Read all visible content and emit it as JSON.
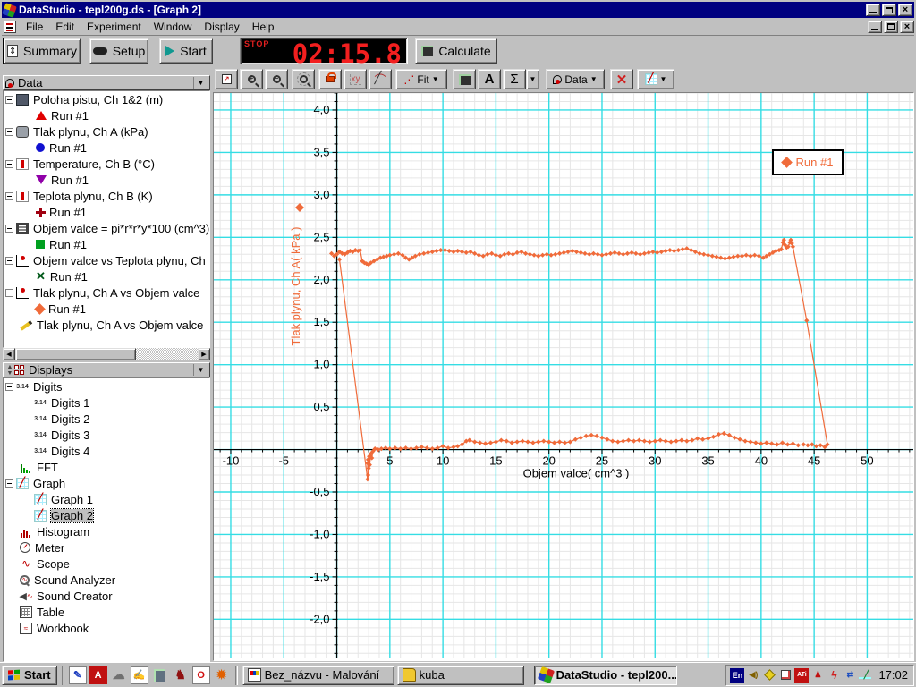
{
  "window": {
    "title": "DataStudio - tepl200g.ds - [Graph 2]"
  },
  "menu": {
    "items": [
      "File",
      "Edit",
      "Experiment",
      "Window",
      "Display",
      "Help"
    ]
  },
  "toolbar": {
    "summary_label": "Summary",
    "setup_label": "Setup",
    "start_label": "Start",
    "timer": {
      "status": "STOP",
      "value": "02:15.8"
    },
    "calculate_label": "Calculate"
  },
  "graph_toolbar": {
    "fit_label": "Fit",
    "text_tool_label": "A",
    "sigma_label": "Σ",
    "data_label": "Data",
    "smart_xy_label": "xy"
  },
  "sidebar": {
    "data_panel": {
      "title": "Data",
      "items": [
        {
          "label": "Poloha pistu, Ch 1&2 (m)"
        },
        {
          "label": "Run #1"
        },
        {
          "label": "Tlak plynu, Ch A (kPa)"
        },
        {
          "label": "Run #1"
        },
        {
          "label": "Temperature, Ch B (°C)"
        },
        {
          "label": "Run #1"
        },
        {
          "label": "Teplota plynu, Ch B (K)"
        },
        {
          "label": "Run #1"
        },
        {
          "label": "Objem valce = pi*r*r*y*100 (cm^3)"
        },
        {
          "label": "Run #1"
        },
        {
          "label": "Objem valce vs Teplota plynu, Ch"
        },
        {
          "label": "Run #1"
        },
        {
          "label": "Tlak plynu, Ch A vs Objem valce"
        },
        {
          "label": "Run #1"
        },
        {
          "label": "Tlak plynu, Ch A vs Objem valce"
        }
      ]
    },
    "displays_panel": {
      "title": "Displays",
      "items": [
        {
          "label": "Digits"
        },
        {
          "label": "Digits 1"
        },
        {
          "label": "Digits 2"
        },
        {
          "label": "Digits 3"
        },
        {
          "label": "Digits 4"
        },
        {
          "label": "FFT"
        },
        {
          "label": "Graph"
        },
        {
          "label": "Graph 1"
        },
        {
          "label": "Graph 2",
          "selected": true
        },
        {
          "label": "Histogram"
        },
        {
          "label": "Meter"
        },
        {
          "label": "Scope"
        },
        {
          "label": "Sound Analyzer"
        },
        {
          "label": "Sound Creator"
        },
        {
          "label": "Table"
        },
        {
          "label": "Workbook"
        }
      ]
    }
  },
  "legend": {
    "label": "Run #1"
  },
  "chart_data": {
    "type": "scatter",
    "xlabel": "Objem valce( cm^3 )",
    "ylabel": "Tlak plynu, Ch A( kPa )",
    "xlim": [
      -11.6,
      54.35
    ],
    "ylim": [
      -2.46,
      4.2
    ],
    "x_major_step": 5,
    "x_minor_step": 1,
    "y_major_step": 0.5,
    "y_minor_step": 0.1,
    "grid": {
      "major_color": "#35dde4",
      "minor_color": "#e6e6e6"
    },
    "xticks": [
      {
        "v": -10,
        "label": "-10"
      },
      {
        "v": -5,
        "label": "-5"
      },
      {
        "v": 5,
        "label": "5"
      },
      {
        "v": 10,
        "label": "10"
      },
      {
        "v": 15,
        "label": "15"
      },
      {
        "v": 20,
        "label": "20"
      },
      {
        "v": 25,
        "label": "25"
      },
      {
        "v": 30,
        "label": "30"
      },
      {
        "v": 35,
        "label": "35"
      },
      {
        "v": 40,
        "label": "40"
      },
      {
        "v": 45,
        "label": "45"
      },
      {
        "v": 50,
        "label": "50"
      }
    ],
    "yticks": [
      {
        "v": 4.0,
        "label": "4,0"
      },
      {
        "v": 3.5,
        "label": "3,5"
      },
      {
        "v": 3.0,
        "label": "3,0"
      },
      {
        "v": 2.5,
        "label": "2,5"
      },
      {
        "v": 2.0,
        "label": "2,0"
      },
      {
        "v": 1.5,
        "label": "1,5"
      },
      {
        "v": 1.0,
        "label": "1,0"
      },
      {
        "v": 0.5,
        "label": "0,5"
      },
      {
        "v": -0.5,
        "label": "-0,5"
      },
      {
        "v": -1.0,
        "label": "-1,0"
      },
      {
        "v": -1.5,
        "label": "-1,5"
      },
      {
        "v": -2.0,
        "label": "-2,0"
      }
    ],
    "series": [
      {
        "name": "Run #1",
        "color": "#f06b3a",
        "points": [
          [
            -0.5,
            2.31
          ],
          [
            -0.25,
            2.28
          ],
          [
            0,
            2.3
          ],
          [
            0.25,
            2.33
          ],
          [
            0.5,
            2.31
          ],
          [
            0.75,
            2.3
          ],
          [
            1.0,
            2.32
          ],
          [
            1.25,
            2.34
          ],
          [
            1.5,
            2.33
          ],
          [
            1.75,
            2.35
          ],
          [
            2.0,
            2.34
          ],
          [
            2.2,
            2.35
          ],
          [
            2.4,
            2.22
          ],
          [
            2.6,
            2.2
          ],
          [
            2.8,
            2.19
          ],
          [
            3.0,
            2.18
          ],
          [
            3.2,
            2.2
          ],
          [
            3.5,
            2.22
          ],
          [
            3.8,
            2.24
          ],
          [
            4.1,
            2.26
          ],
          [
            4.4,
            2.27
          ],
          [
            4.7,
            2.28
          ],
          [
            5.0,
            2.29
          ],
          [
            5.4,
            2.3
          ],
          [
            5.8,
            2.31
          ],
          [
            6.2,
            2.29
          ],
          [
            6.5,
            2.26
          ],
          [
            6.8,
            2.24
          ],
          [
            7.1,
            2.26
          ],
          [
            7.4,
            2.28
          ],
          [
            7.8,
            2.3
          ],
          [
            8.2,
            2.31
          ],
          [
            8.6,
            2.32
          ],
          [
            9.0,
            2.33
          ],
          [
            9.4,
            2.34
          ],
          [
            9.8,
            2.35
          ],
          [
            10.2,
            2.35
          ],
          [
            10.6,
            2.34
          ],
          [
            11.0,
            2.33
          ],
          [
            11.4,
            2.34
          ],
          [
            11.8,
            2.33
          ],
          [
            12.2,
            2.32
          ],
          [
            12.6,
            2.33
          ],
          [
            13.0,
            2.31
          ],
          [
            13.4,
            2.29
          ],
          [
            13.8,
            2.28
          ],
          [
            14.2,
            2.3
          ],
          [
            14.6,
            2.31
          ],
          [
            15.0,
            2.29
          ],
          [
            15.4,
            2.28
          ],
          [
            15.8,
            2.3
          ],
          [
            16.2,
            2.31
          ],
          [
            16.6,
            2.3
          ],
          [
            17.0,
            2.32
          ],
          [
            17.4,
            2.33
          ],
          [
            17.8,
            2.31
          ],
          [
            18.2,
            2.3
          ],
          [
            18.6,
            2.29
          ],
          [
            19.0,
            2.28
          ],
          [
            19.4,
            2.29
          ],
          [
            19.8,
            2.3
          ],
          [
            20.2,
            2.29
          ],
          [
            20.6,
            2.3
          ],
          [
            21.0,
            2.31
          ],
          [
            21.4,
            2.32
          ],
          [
            21.8,
            2.33
          ],
          [
            22.2,
            2.34
          ],
          [
            22.6,
            2.33
          ],
          [
            23.0,
            2.32
          ],
          [
            23.4,
            2.31
          ],
          [
            23.8,
            2.3
          ],
          [
            24.2,
            2.31
          ],
          [
            24.6,
            2.3
          ],
          [
            25.0,
            2.29
          ],
          [
            25.4,
            2.3
          ],
          [
            25.8,
            2.31
          ],
          [
            26.2,
            2.32
          ],
          [
            26.6,
            2.31
          ],
          [
            27.0,
            2.3
          ],
          [
            27.4,
            2.31
          ],
          [
            27.8,
            2.32
          ],
          [
            28.2,
            2.31
          ],
          [
            28.6,
            2.3
          ],
          [
            29.0,
            2.31
          ],
          [
            29.4,
            2.32
          ],
          [
            29.8,
            2.33
          ],
          [
            30.2,
            2.32
          ],
          [
            30.6,
            2.33
          ],
          [
            31.0,
            2.34
          ],
          [
            31.4,
            2.35
          ],
          [
            31.8,
            2.34
          ],
          [
            32.2,
            2.35
          ],
          [
            32.6,
            2.36
          ],
          [
            33.0,
            2.37
          ],
          [
            33.4,
            2.35
          ],
          [
            33.8,
            2.33
          ],
          [
            34.2,
            2.31
          ],
          [
            34.6,
            2.3
          ],
          [
            35.0,
            2.29
          ],
          [
            35.4,
            2.28
          ],
          [
            35.8,
            2.27
          ],
          [
            36.2,
            2.26
          ],
          [
            36.6,
            2.25
          ],
          [
            37.0,
            2.26
          ],
          [
            37.4,
            2.27
          ],
          [
            37.8,
            2.28
          ],
          [
            38.2,
            2.28
          ],
          [
            38.6,
            2.29
          ],
          [
            39.0,
            2.28
          ],
          [
            39.4,
            2.29
          ],
          [
            39.8,
            2.28
          ],
          [
            40.2,
            2.26
          ],
          [
            40.5,
            2.28
          ],
          [
            40.8,
            2.3
          ],
          [
            41.1,
            2.32
          ],
          [
            41.4,
            2.34
          ],
          [
            41.7,
            2.35
          ],
          [
            41.9,
            2.36
          ],
          [
            42.05,
            2.44
          ],
          [
            42.15,
            2.47
          ],
          [
            42.25,
            2.41
          ],
          [
            42.4,
            2.38
          ],
          [
            42.55,
            2.39
          ],
          [
            42.7,
            2.44
          ],
          [
            42.8,
            2.47
          ],
          [
            42.9,
            2.43
          ],
          [
            43.0,
            2.39
          ],
          [
            44.3,
            1.52
          ],
          [
            46.25,
            0.06
          ],
          [
            46.0,
            0.03
          ],
          [
            45.6,
            0.05
          ],
          [
            45.2,
            0.04
          ],
          [
            44.8,
            0.06
          ],
          [
            44.4,
            0.05
          ],
          [
            44.0,
            0.06
          ],
          [
            43.5,
            0.05
          ],
          [
            43.0,
            0.07
          ],
          [
            42.5,
            0.06
          ],
          [
            42.0,
            0.08
          ],
          [
            41.5,
            0.06
          ],
          [
            41.0,
            0.07
          ],
          [
            40.5,
            0.08
          ],
          [
            40.0,
            0.07
          ],
          [
            39.5,
            0.08
          ],
          [
            39.0,
            0.09
          ],
          [
            38.5,
            0.1
          ],
          [
            38.0,
            0.12
          ],
          [
            37.5,
            0.14
          ],
          [
            37.0,
            0.17
          ],
          [
            36.5,
            0.19
          ],
          [
            36.0,
            0.18
          ],
          [
            35.5,
            0.15
          ],
          [
            35.0,
            0.13
          ],
          [
            34.5,
            0.12
          ],
          [
            34.0,
            0.13
          ],
          [
            33.5,
            0.11
          ],
          [
            33.0,
            0.1
          ],
          [
            32.5,
            0.11
          ],
          [
            32.0,
            0.1
          ],
          [
            31.5,
            0.09
          ],
          [
            31.0,
            0.1
          ],
          [
            30.5,
            0.11
          ],
          [
            30.0,
            0.1
          ],
          [
            29.5,
            0.09
          ],
          [
            29.0,
            0.1
          ],
          [
            28.5,
            0.11
          ],
          [
            28.0,
            0.1
          ],
          [
            27.5,
            0.11
          ],
          [
            27.0,
            0.1
          ],
          [
            26.5,
            0.09
          ],
          [
            26.0,
            0.1
          ],
          [
            25.5,
            0.12
          ],
          [
            25.0,
            0.14
          ],
          [
            24.5,
            0.16
          ],
          [
            24.0,
            0.17
          ],
          [
            23.5,
            0.16
          ],
          [
            23.0,
            0.14
          ],
          [
            22.5,
            0.12
          ],
          [
            22.0,
            0.09
          ],
          [
            21.5,
            0.08
          ],
          [
            21.0,
            0.09
          ],
          [
            20.5,
            0.08
          ],
          [
            20.0,
            0.09
          ],
          [
            19.5,
            0.1
          ],
          [
            19.0,
            0.09
          ],
          [
            18.5,
            0.08
          ],
          [
            18.0,
            0.09
          ],
          [
            17.5,
            0.1
          ],
          [
            17.0,
            0.09
          ],
          [
            16.5,
            0.08
          ],
          [
            16.0,
            0.1
          ],
          [
            15.5,
            0.11
          ],
          [
            15.0,
            0.09
          ],
          [
            14.5,
            0.08
          ],
          [
            14.0,
            0.07
          ],
          [
            13.5,
            0.08
          ],
          [
            13.0,
            0.09
          ],
          [
            12.5,
            0.11
          ],
          [
            12.2,
            0.1
          ],
          [
            11.8,
            0.06
          ],
          [
            11.4,
            0.04
          ],
          [
            11.0,
            0.03
          ],
          [
            10.5,
            0.02
          ],
          [
            10.0,
            0.04
          ],
          [
            9.5,
            0.02
          ],
          [
            9.0,
            0.01
          ],
          [
            8.5,
            0.02
          ],
          [
            8.0,
            0.03
          ],
          [
            7.5,
            0.02
          ],
          [
            7.0,
            0.01
          ],
          [
            6.5,
            0.02
          ],
          [
            6.0,
            0.01
          ],
          [
            5.5,
            0.02
          ],
          [
            5.0,
            0.01
          ],
          [
            4.6,
            0.02
          ],
          [
            4.2,
            0.01
          ],
          [
            3.9,
            0.0
          ],
          [
            3.6,
            0.01
          ],
          [
            3.4,
            -0.02
          ],
          [
            3.3,
            -0.1
          ],
          [
            3.2,
            -0.05
          ],
          [
            3.1,
            -0.18
          ],
          [
            3.05,
            -0.08
          ],
          [
            3.0,
            -0.22
          ],
          [
            2.95,
            -0.12
          ],
          [
            2.9,
            -0.16
          ],
          [
            2.95,
            -0.3
          ],
          [
            2.9,
            -0.35
          ],
          [
            0.25,
            2.24
          ]
        ]
      }
    ]
  },
  "taskbar": {
    "start_label": "Start",
    "tasks": [
      {
        "label": "Bez_názvu - Malování"
      },
      {
        "label": "kuba"
      },
      {
        "label": "DataStudio - tepl200..."
      }
    ],
    "tray": {
      "keyboard_layout": "En",
      "clock": "17:02"
    }
  }
}
